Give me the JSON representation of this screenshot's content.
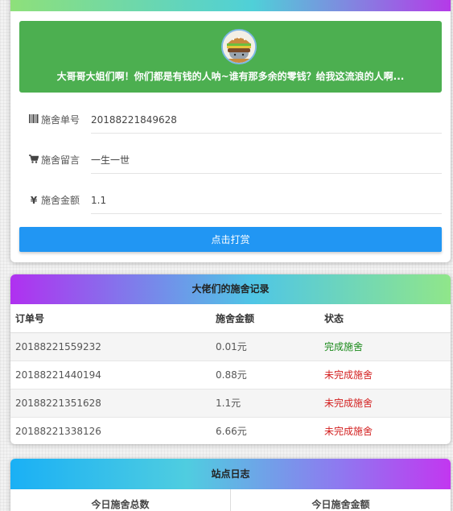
{
  "banner": {
    "avatar_icon": "burger-cat-icon",
    "message": "大哥哥大姐们啊！你们都是有钱的人呐~谁有那多余的零钱？给我这流浪的人啊..."
  },
  "form": {
    "order": {
      "icon": "barcode-icon",
      "label": "施舍单号",
      "value": "20188221849628"
    },
    "message": {
      "icon": "cart-icon",
      "label": "施舍留言",
      "value": "一生一世"
    },
    "amount": {
      "icon": "yen-icon",
      "label": "施舍金额",
      "value": "1.1"
    },
    "submit_label": "点击打赏"
  },
  "records": {
    "title": "大佬们的施舍记录",
    "columns": [
      "订单号",
      "施舍金额",
      "状态"
    ],
    "rows": [
      {
        "order": "20188221559232",
        "amount": "0.01元",
        "status": "完成施舍",
        "done": true
      },
      {
        "order": "20188221440194",
        "amount": "0.88元",
        "status": "未完成施舍",
        "done": false
      },
      {
        "order": "20188221351628",
        "amount": "1.1元",
        "status": "未完成施舍",
        "done": false
      },
      {
        "order": "20188221338126",
        "amount": "6.66元",
        "status": "未完成施舍",
        "done": false
      }
    ]
  },
  "site_log": {
    "title": "站点日志",
    "columns": [
      "今日施舍总数",
      "今日施舍金额"
    ]
  },
  "colors": {
    "banner": "#4caf50",
    "button": "#2196f3",
    "done": "#1a8a1a",
    "pending": "#d32020"
  }
}
